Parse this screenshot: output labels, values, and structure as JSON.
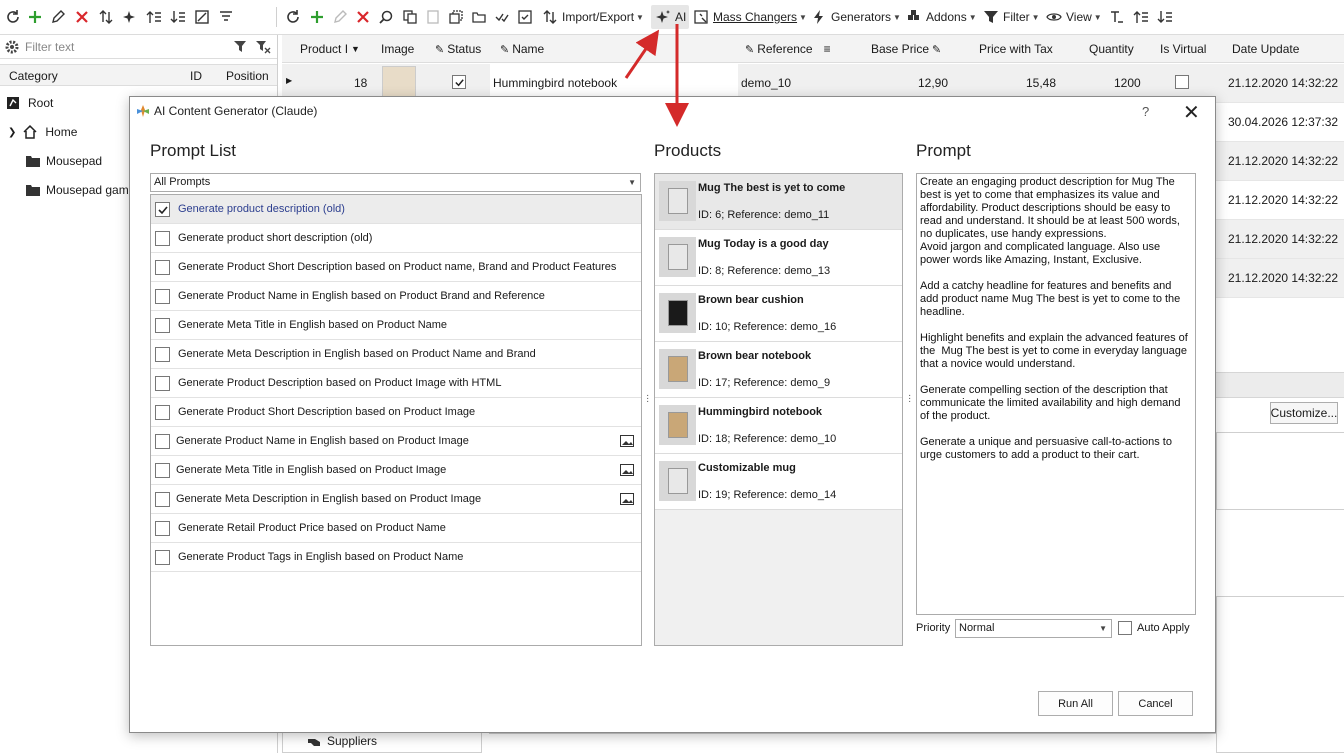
{
  "toolbar": {
    "import_export": "Import/Export",
    "ai": "AI",
    "mass_changers": "Mass Changers",
    "generators": "Generators",
    "addons": "Addons",
    "filter": "Filter",
    "view": "View"
  },
  "left": {
    "filter_placeholder": "Filter text",
    "columns": {
      "category": "Category",
      "id": "ID",
      "position": "Position"
    },
    "tree": [
      "Root",
      "Home",
      "Mousepad",
      "Mousepad gami"
    ]
  },
  "grid": {
    "columns": [
      "Product I",
      "Image",
      "Status",
      "Name",
      "Reference",
      "Base Price",
      "Price with Tax",
      "Quantity",
      "Is Virtual",
      "Date Update"
    ],
    "first_row": {
      "id": "18",
      "name": "Hummingbird notebook",
      "reference": "demo_10",
      "base_price": "12,90",
      "price_tax": "15,48",
      "quantity": "1200",
      "date": "21.12.2020 14:32:22"
    },
    "dates": [
      "30.04.2026 12:37:32",
      "21.12.2020 14:32:22",
      "21.12.2020 14:32:22",
      "21.12.2020 14:32:22",
      "21.12.2020 14:32:22"
    ],
    "customize": "Customize...",
    "suppliers": "Suppliers"
  },
  "dialog": {
    "title": "AI Content Generator (Claude)",
    "help": "?",
    "close": "✕",
    "prompt_list_title": "Prompt List",
    "products_title": "Products",
    "prompt_title": "Prompt",
    "combo_value": "All Prompts",
    "prompts": [
      {
        "label": "Generate product description (old)",
        "checked": true,
        "image": false
      },
      {
        "label": "Generate product short description (old)",
        "checked": false,
        "image": false
      },
      {
        "label": "Generate Product Short Description based on Product name, Brand and Product Features",
        "checked": false,
        "image": false
      },
      {
        "label": "Generate Product Name in English based on Product Brand and Reference",
        "checked": false,
        "image": false
      },
      {
        "label": "Generate Meta Title in English based on Product Name",
        "checked": false,
        "image": false
      },
      {
        "label": "Generate Meta Description in English based on Product Name and Brand",
        "checked": false,
        "image": false
      },
      {
        "label": "Generate Product Description based on Product Image with HTML",
        "checked": false,
        "image": false
      },
      {
        "label": "Generate Product Short Description based on Product Image",
        "checked": false,
        "image": false
      },
      {
        "label": "Generate Product Name in English based on Product Image",
        "checked": false,
        "image": true
      },
      {
        "label": "Generate Meta Title in English based on Product Image",
        "checked": false,
        "image": true
      },
      {
        "label": "Generate Meta Description in English based on Product Image",
        "checked": false,
        "image": true
      },
      {
        "label": "Generate Retail Product Price based on Product Name",
        "checked": false,
        "image": false
      },
      {
        "label": "Generate Product Tags in English based on Product Name",
        "checked": false,
        "image": false
      }
    ],
    "products": [
      {
        "name": "Mug The best is yet to come",
        "info": "ID: 6; Reference: demo_11"
      },
      {
        "name": "Mug Today is a good day",
        "info": "ID: 8; Reference: demo_13"
      },
      {
        "name": "Brown bear cushion",
        "info": "ID: 10; Reference: demo_16"
      },
      {
        "name": "Brown bear notebook",
        "info": "ID: 17; Reference: demo_9"
      },
      {
        "name": "Hummingbird notebook",
        "info": "ID: 18; Reference: demo_10"
      },
      {
        "name": "Customizable mug",
        "info": "ID: 19; Reference: demo_14"
      }
    ],
    "prompt_text": "Create an engaging product description for Mug The best is yet to come that emphasizes its value and affordability. Product descriptions should be easy to read and understand. It should be at least 500 words, no duplicates, use handy expressions.\nAvoid jargon and complicated language. Also use power words like Amazing, Instant, Exclusive.\n\nAdd a catchy headline for features and benefits and add product name Mug The best is yet to come to the headline.\n\nHighlight benefits and explain the advanced features of the  Mug The best is yet to come in everyday language that a novice would understand.\n\nGenerate compelling section of the description that communicate the limited availability and high demand of the product.\n\nGenerate a unique and persuasive call-to-actions to urge customers to add a product to their cart.",
    "priority_label": "Priority",
    "priority_value": "Normal",
    "auto_apply": "Auto Apply",
    "run_all": "Run All",
    "cancel": "Cancel"
  },
  "colors": {
    "accent_arrow": "#d42a2a",
    "selection": "#2c3e8f",
    "green_icon": "#2e9e2e",
    "red_icon": "#d9262b"
  }
}
